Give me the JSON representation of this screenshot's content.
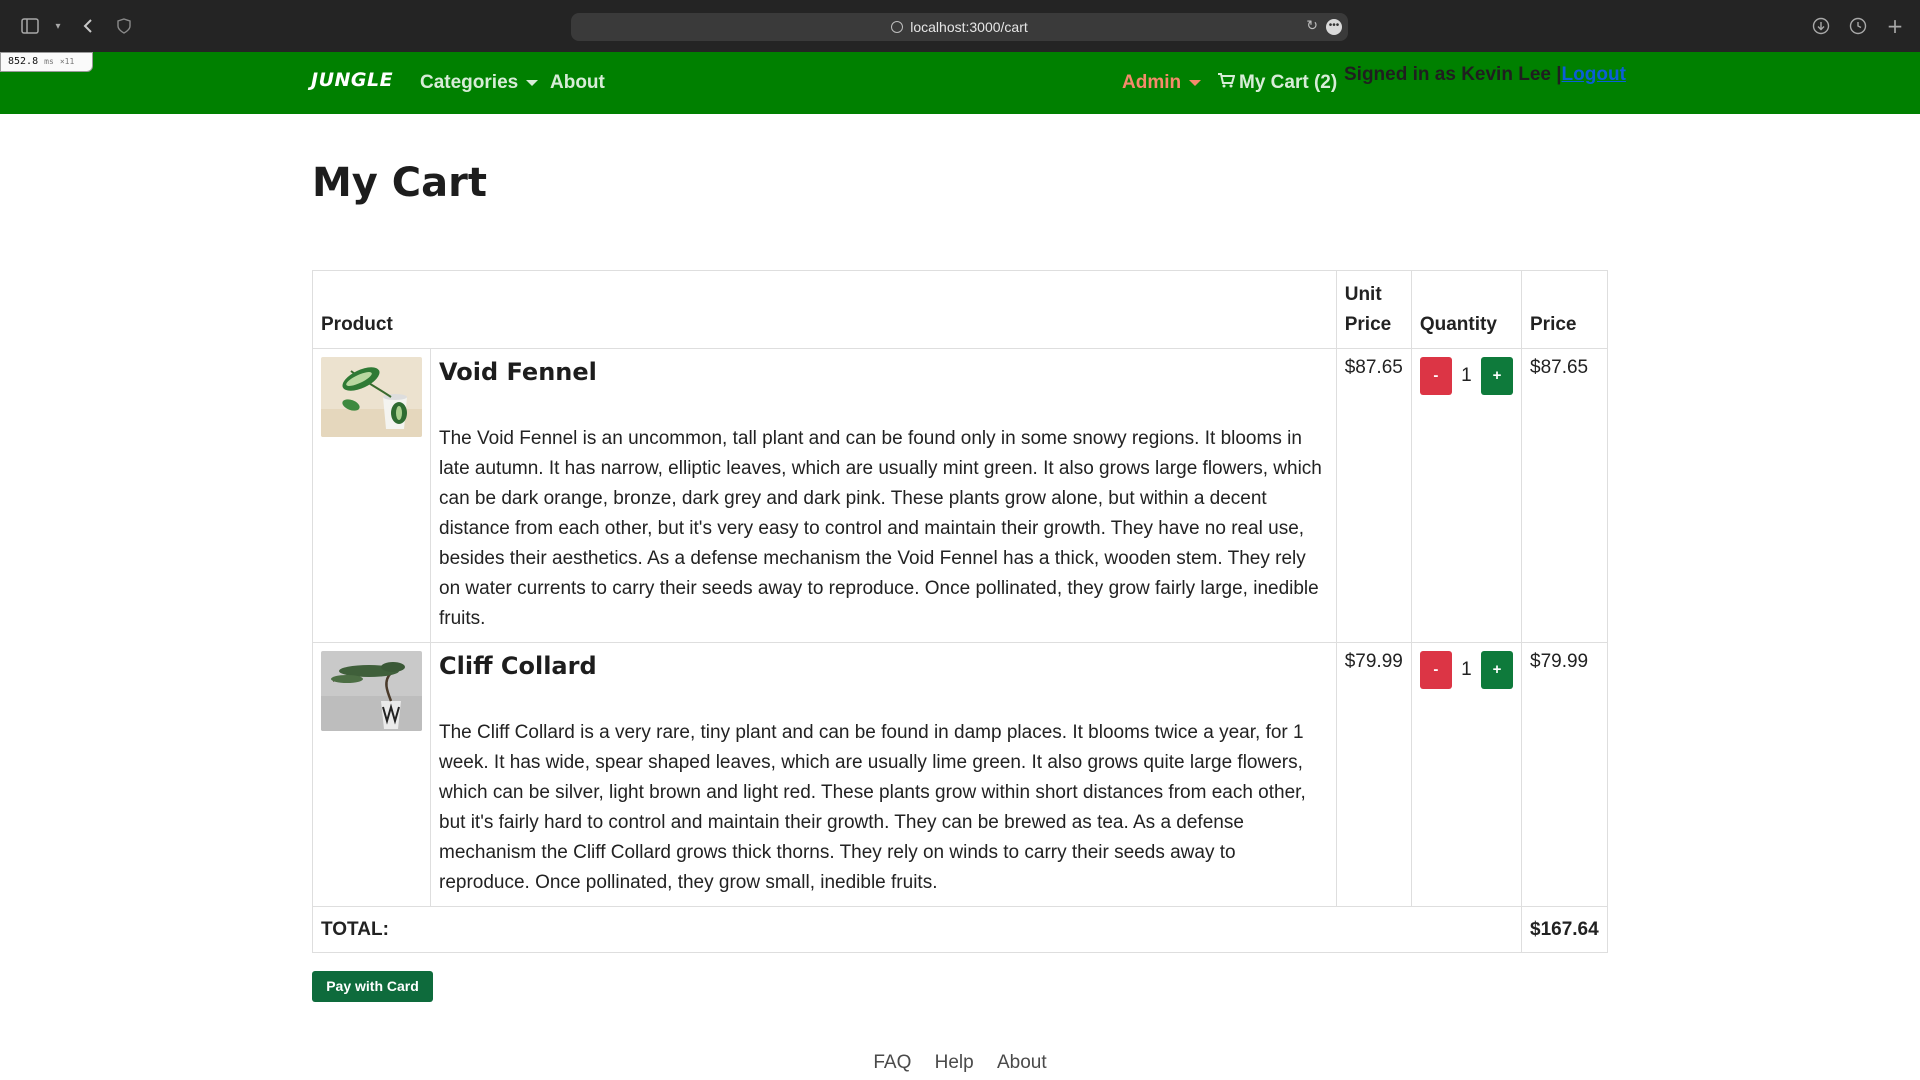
{
  "browser": {
    "url": "localhost:3000/cart",
    "perf_value": "852.8",
    "perf_unit": "ms",
    "perf_extra": "×11"
  },
  "navbar": {
    "brand": "JUNGLE",
    "categories": "Categories",
    "about": "About",
    "admin": "Admin",
    "cart": "My Cart (2)",
    "signed_in_text": "Signed in as Kevin Lee |",
    "logout": "Logout",
    "color": "#008000"
  },
  "page": {
    "title": "My Cart"
  },
  "table": {
    "headers": {
      "product": "Product",
      "unit_price_line1": "Unit",
      "unit_price_line2": "Price",
      "quantity": "Quantity",
      "price": "Price"
    },
    "items": [
      {
        "name": "Void Fennel",
        "description": "The Void Fennel is an uncommon, tall plant and can be found only in some snowy regions. It blooms in late autumn. It has narrow, elliptic leaves, which are usually mint green. It also grows large flowers, which can be dark orange, bronze, dark grey and dark pink. These plants grow alone, but within a decent distance from each other, but it's very easy to control and maintain their growth. They have no real use, besides their aesthetics. As a defense mechanism the Void Fennel has a thick, wooden stem. They rely on water currents to carry their seeds away to reproduce. Once pollinated, they grow fairly large, inedible fruits.",
        "unit_price": "$87.65",
        "minus": "-",
        "quantity": "1",
        "plus": "+",
        "price": "$87.65"
      },
      {
        "name": "Cliff Collard",
        "description": "The Cliff Collard is a very rare, tiny plant and can be found in damp places. It blooms twice a year, for 1 week. It has wide, spear shaped leaves, which are usually lime green. It also grows quite large flowers, which can be silver, light brown and light red. These plants grow within short distances from each other, but it's fairly hard to control and maintain their growth. They can be brewed as tea. As a defense mechanism the Cliff Collard grows thick thorns. They rely on winds to carry their seeds away to reproduce. Once pollinated, they grow small, inedible fruits.",
        "unit_price": "$79.99",
        "minus": "-",
        "quantity": "1",
        "plus": "+",
        "price": "$79.99"
      }
    ],
    "total_label": "TOTAL:",
    "total_value": "$167.64"
  },
  "pay_button": "Pay with Card",
  "footer": {
    "faq": "FAQ",
    "help": "Help",
    "about": "About"
  }
}
